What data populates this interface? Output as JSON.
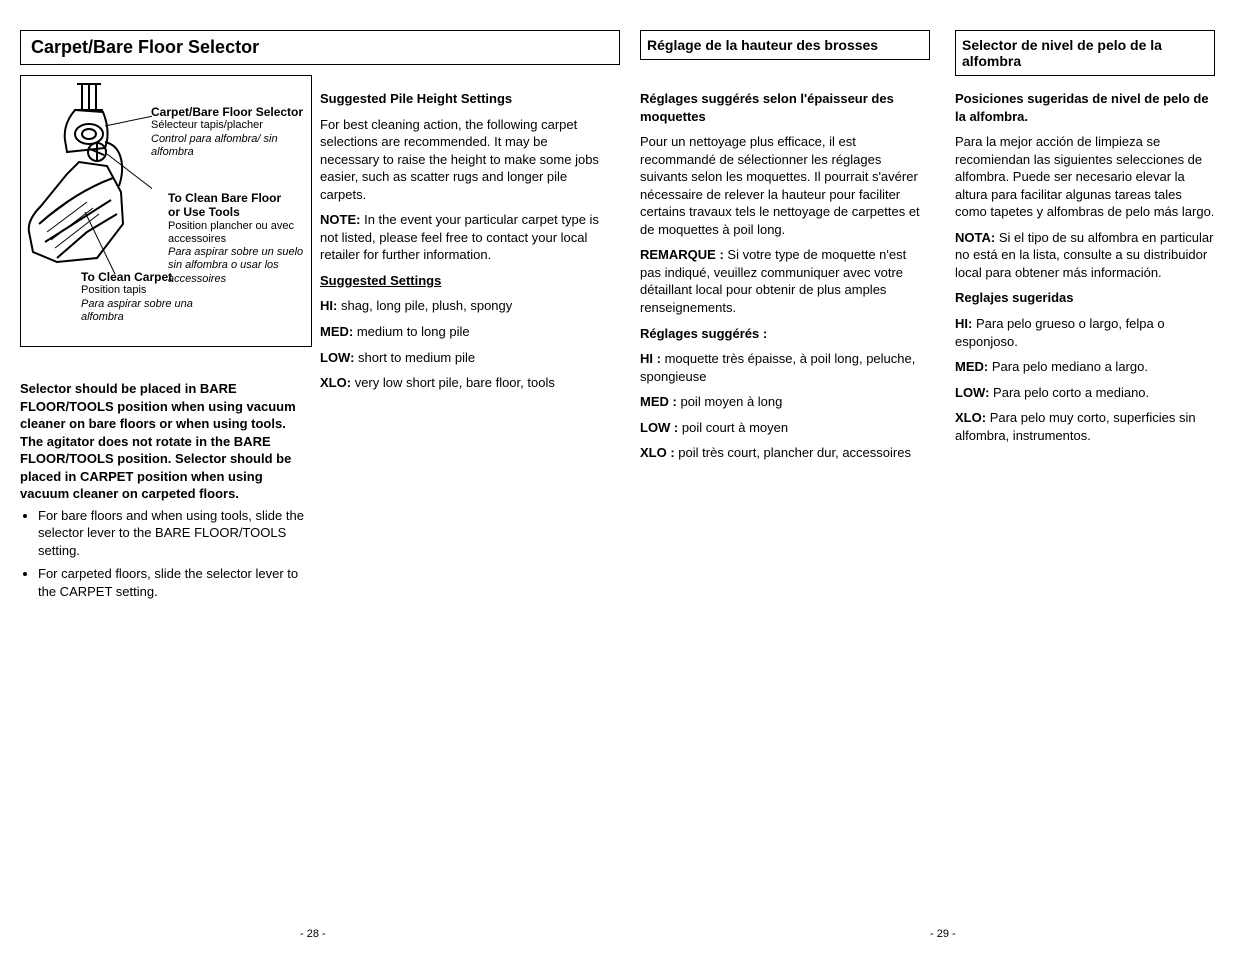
{
  "left": {
    "section_title": "Carpet/Bare Floor Selector",
    "diagram": {
      "callout_selector": {
        "en": "Carpet/Bare Floor Selector",
        "fr": "Sélecteur tapis/placher",
        "es": "Control para alfombra/ sin alfombra"
      },
      "callout_bare": {
        "en1": "To Clean Bare Floor",
        "en2": "or Use Tools",
        "fr": "Position plancher ou avec accessoires",
        "es": "Para aspirar sobre un suelo sin alfombra o usar los accessoires"
      },
      "callout_carpet": {
        "en": "To Clean Carpet",
        "fr": "Position tapis",
        "es": "Para aspirar sobre una alfombra"
      }
    },
    "body1": {
      "lead": "Selector should be placed in BARE FLOOR/TOOLS position when using vacuum cleaner on bare floors or when using tools. The agitator does not rotate in the BARE FLOOR/TOOLS position. Selector should be placed in CARPET position when using vacuum cleaner on carpeted floors.",
      "bullets": [
        "For bare floors and when using tools, slide the selector lever to the BARE FLOOR/TOOLS setting.",
        "For carpeted floors, slide the selector lever to the CARPET setting."
      ]
    },
    "body2": {
      "heading": "Suggested Pile Height Settings",
      "intro": "For best cleaning action, the following carpet selections are recommended. It may be necessary to raise the height to make some jobs easier, such as scatter rugs and longer pile carpets.",
      "note_label": "NOTE:",
      "note": "In the event your particular carpet type is not listed, please feel free to contact your local retailer for further information.",
      "sugg_label": "Suggested Settings",
      "rows": [
        {
          "k": "HI:",
          "v": "shag, long pile, plush, spongy"
        },
        {
          "k": "MED:",
          "v": "medium to long pile"
        },
        {
          "k": "LOW:",
          "v": "short to medium pile"
        },
        {
          "k": "XLO:",
          "v": "very low short pile, bare floor, tools"
        }
      ]
    }
  },
  "mid": {
    "section_title": "Réglage de la hauteur des brosses",
    "heading": "Réglages suggérés selon l'épaisseur des moquettes",
    "intro": "Pour un nettoyage plus efficace, il est recommandé de sélectionner les réglages suivants selon les moquettes. Il pourrait s'avérer nécessaire de relever la hauteur pour faciliter certains travaux tels le nettoyage de carpettes et de moquettes à poil long.",
    "note_label": "REMARQUE :",
    "note": "Si votre type de moquette n'est pas indiqué, veuillez communiquer avec votre détaillant local pour obtenir de plus amples renseignements.",
    "sugg_label": "Réglages suggérés :",
    "rows": [
      {
        "k": "HI :",
        "v": "moquette très épaisse, à poil long, peluche, spongieuse"
      },
      {
        "k": "MED :",
        "v": "poil moyen à long"
      },
      {
        "k": "LOW :",
        "v": "poil court à moyen"
      },
      {
        "k": "XLO :",
        "v": "poil très court, plancher dur, accessoires"
      }
    ]
  },
  "right": {
    "section_title": "Selector de nivel de pelo de la alfombra",
    "heading": "Posiciones sugeridas de nivel de pelo de la alfombra.",
    "intro": "Para la mejor acción de limpieza se recomiendan las siguientes selecciones de alfombra. Puede ser necesario elevar la altura para facilitar algunas tareas tales como tapetes y alfombras de pelo más largo.",
    "note_label": "NOTA:",
    "note": "Si el tipo de su alfombra en particular no está en la lista, consulte a su distribuidor local para obtener más información.",
    "sugg_label": "Reglajes sugeridas",
    "rows": [
      {
        "k": "HI:",
        "v": "Para pelo grueso o largo, felpa o esponjoso."
      },
      {
        "k": "MED:",
        "v": "Para pelo mediano a largo."
      },
      {
        "k": "LOW:",
        "v": "Para pelo corto a mediano."
      },
      {
        "k": "XLO:",
        "v": "Para pelo muy corto, superficies sin alfombra, instrumentos."
      }
    ]
  },
  "pages": {
    "left": "- 28 -",
    "right": "- 29 -"
  }
}
